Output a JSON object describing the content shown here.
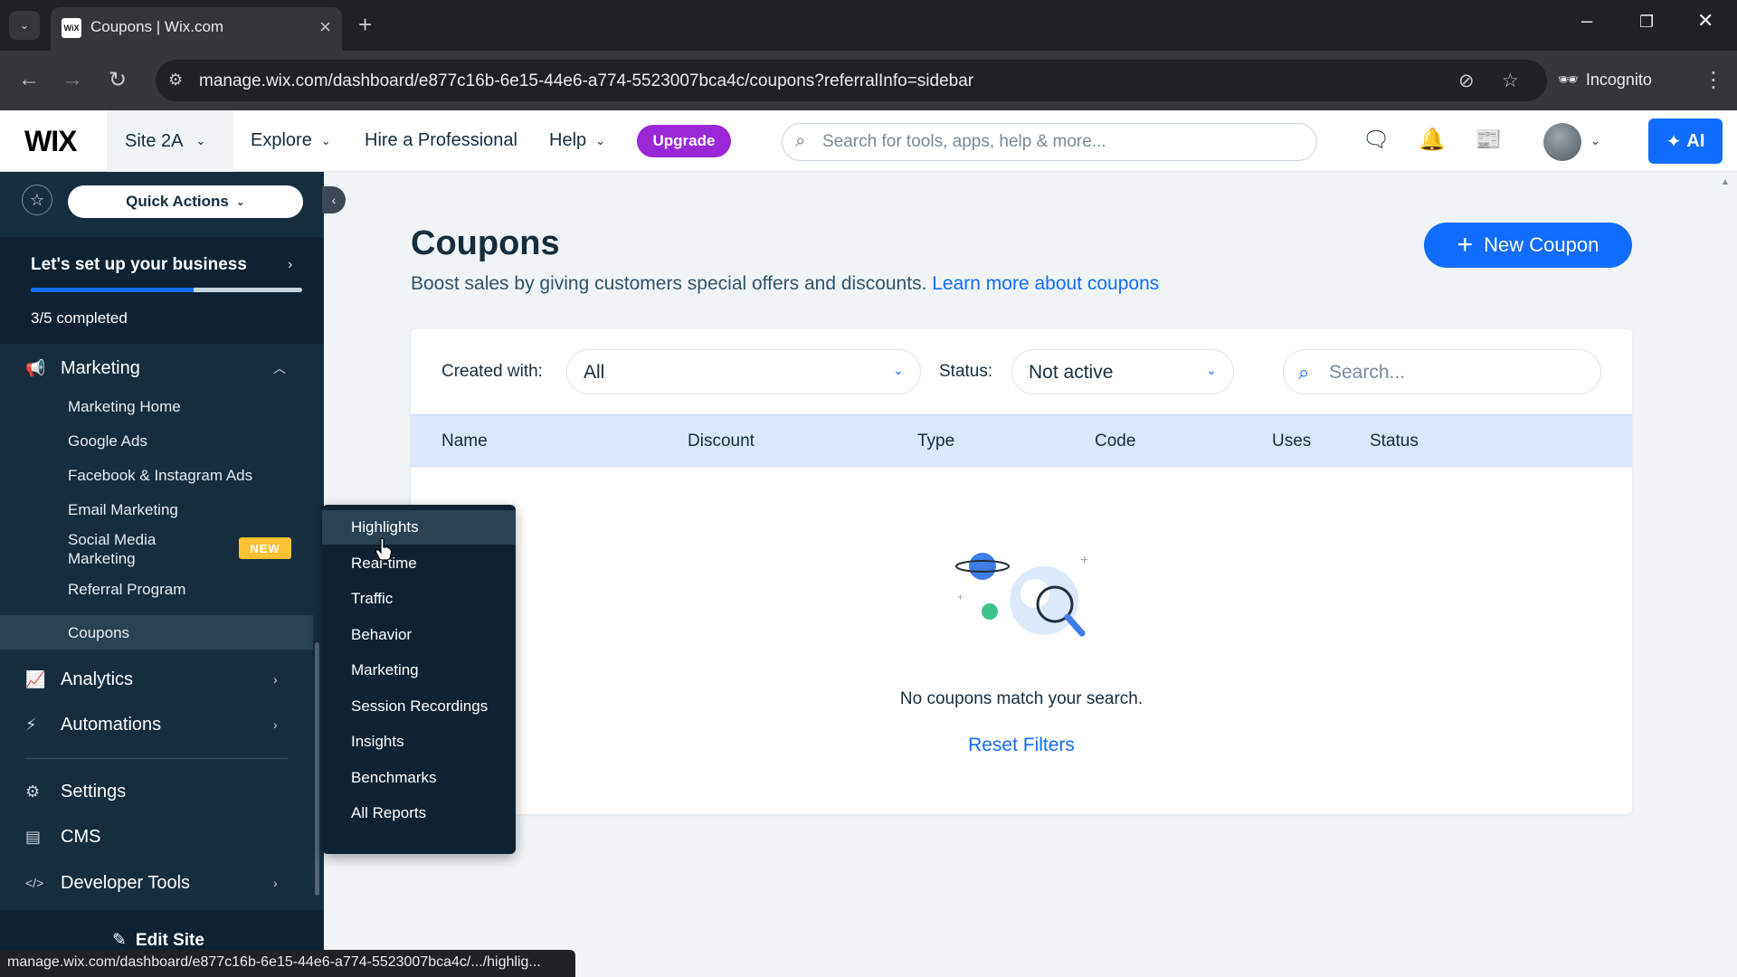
{
  "browser": {
    "tab_title": "Coupons | Wix.com",
    "url": "manage.wix.com/dashboard/e877c16b-6e15-44e6-a774-5523007bca4c/coupons?referralInfo=sidebar",
    "incognito_label": "Incognito",
    "status_url": "manage.wix.com/dashboard/e877c16b-6e15-44e6-a774-5523007bca4c/.../highlig..."
  },
  "topbar": {
    "logo": "WIX",
    "site": "Site 2A",
    "explore": "Explore",
    "hire": "Hire a Professional",
    "help": "Help",
    "upgrade": "Upgrade",
    "search_placeholder": "Search for tools, apps, help & more...",
    "ai_label": "AI"
  },
  "sidebar": {
    "quick_actions": "Quick Actions",
    "setup_title": "Let's set up your business",
    "setup_progress": 0.6,
    "setup_count": "3/5 completed",
    "marketing_label": "Marketing",
    "marketing_items": [
      {
        "label": "Marketing Home"
      },
      {
        "label": "Google Ads"
      },
      {
        "label": "Facebook & Instagram Ads"
      },
      {
        "label": "Email Marketing"
      },
      {
        "label": "Social Media Marketing",
        "badge": "NEW"
      },
      {
        "label": "Referral Program"
      },
      {
        "label": "Coupons",
        "active": true
      }
    ],
    "analytics": "Analytics",
    "automations": "Automations",
    "settings": "Settings",
    "cms": "CMS",
    "developer_tools": "Developer Tools",
    "edit_site": "Edit Site"
  },
  "analytics_flyout": {
    "items": [
      "Highlights",
      "Real-time",
      "Traffic",
      "Behavior",
      "Marketing",
      "Session Recordings",
      "Insights",
      "Benchmarks",
      "All Reports"
    ],
    "hovered": "Highlights"
  },
  "main": {
    "title": "Coupons",
    "subtitle": "Boost sales by giving customers special offers and discounts.",
    "learn_more": "Learn more about coupons",
    "new_coupon": "New Coupon",
    "filters": {
      "created_with_label": "Created with:",
      "created_with_value": "All",
      "status_label": "Status:",
      "status_value": "Not active",
      "search_placeholder": "Search..."
    },
    "columns": [
      "Name",
      "Discount",
      "Type",
      "Code",
      "Uses",
      "Status"
    ],
    "empty_message": "No coupons match your search.",
    "reset_filters": "Reset Filters"
  },
  "colors": {
    "accent": "#116dff",
    "sidebar_bg": "#162d3d",
    "upgrade": "#9a27d5",
    "new_badge": "#ffc233"
  }
}
